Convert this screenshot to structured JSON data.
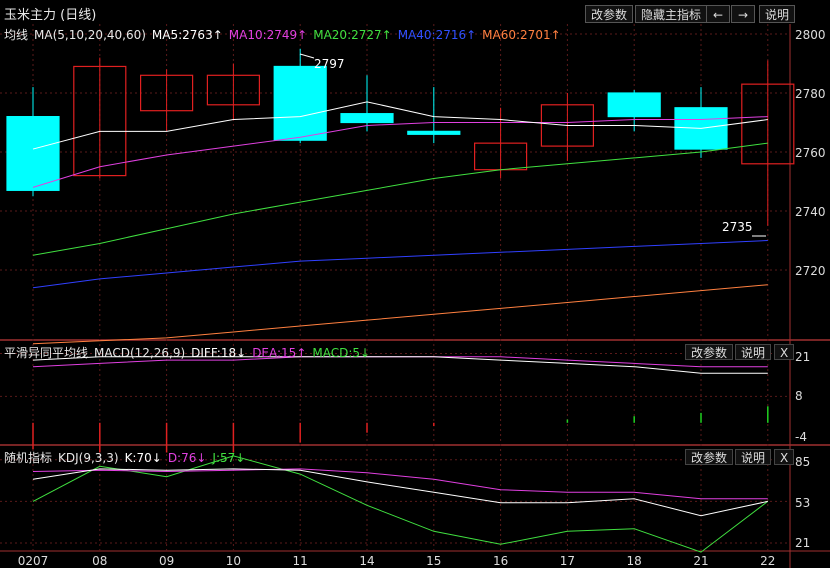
{
  "window": {
    "title": "玉米主力 (日线)"
  },
  "toolbar": {
    "params": "改参数",
    "hide_main": "隐藏主指标",
    "left_arrow": "←",
    "right_arrow": "→",
    "help": "说明"
  },
  "main_panel": {
    "legend": {
      "name": "均线",
      "params": "MA(5,10,20,40,60)",
      "ma5": "MA5:2763↑",
      "ma10": "MA10:2749↑",
      "ma20": "MA20:2727↑",
      "ma40": "MA40:2716↑",
      "ma60": "MA60:2701↑"
    },
    "colors": {
      "ma5": "#ffffff",
      "ma10": "#e040e0",
      "ma20": "#40e040",
      "ma40": "#3040ff",
      "ma60": "#ff8040",
      "up": "#e02020",
      "down": "#00ffff"
    },
    "high_label": "2797",
    "low_label": "2735",
    "yticks": [
      "2800",
      "2780",
      "2760",
      "2740",
      "2720"
    ]
  },
  "macd_panel": {
    "legend": {
      "name": "平滑异同平均线",
      "params": "MACD(12,26,9)",
      "diff": "DIFF:18↓",
      "dea": "DEA:15↑",
      "macd": "MACD:5↓"
    },
    "params_btn": "改参数",
    "help_btn": "说明",
    "close_btn": "X",
    "yticks": [
      "21",
      "8",
      "-4"
    ]
  },
  "kdj_panel": {
    "legend": {
      "name": "随机指标",
      "params": "KDJ(9,3,3)",
      "k": "K:70↓",
      "d": "D:76↓",
      "j": "J:57↓"
    },
    "params_btn": "改参数",
    "help_btn": "说明",
    "close_btn": "X",
    "yticks": [
      "85",
      "53",
      "21"
    ]
  },
  "xaxis": {
    "labels": [
      "0207",
      "08",
      "09",
      "10",
      "11",
      "14",
      "15",
      "16",
      "17",
      "18",
      "21",
      "22"
    ]
  },
  "chart_data": {
    "type": "candlestick",
    "x": [
      "0207",
      "08",
      "09",
      "10",
      "11",
      "14",
      "15",
      "16",
      "17",
      "18",
      "21",
      "22"
    ],
    "candles": [
      {
        "open": 2772,
        "close": 2747,
        "high": 2782,
        "low": 2745
      },
      {
        "open": 2752,
        "close": 2789,
        "high": 2792,
        "low": 2751
      },
      {
        "open": 2774,
        "close": 2786,
        "high": 2788,
        "low": 2767
      },
      {
        "open": 2776,
        "close": 2786,
        "high": 2790,
        "low": 2771
      },
      {
        "open": 2789,
        "close": 2764,
        "high": 2795,
        "low": 2763
      },
      {
        "open": 2773,
        "close": 2770,
        "high": 2786,
        "low": 2767
      },
      {
        "open": 2767,
        "close": 2766,
        "high": 2782,
        "low": 2763
      },
      {
        "open": 2754,
        "close": 2763,
        "high": 2775,
        "low": 2751
      },
      {
        "open": 2762,
        "close": 2776,
        "high": 2780,
        "low": 2757
      },
      {
        "open": 2780,
        "close": 2772,
        "high": 2781,
        "low": 2767
      },
      {
        "open": 2775,
        "close": 2761,
        "high": 2782,
        "low": 2758
      },
      {
        "open": 2756,
        "close": 2783,
        "high": 2791,
        "low": 2735
      }
    ],
    "ma5": [
      2761,
      2767,
      2767,
      2771,
      2772,
      2777,
      2772,
      2771,
      2769,
      2769,
      2768,
      2771
    ],
    "ma10": [
      2748,
      2755,
      2759,
      2762,
      2765,
      2769,
      2770,
      2770,
      2770,
      2771,
      2771,
      2772
    ],
    "ma20": [
      2725,
      2729,
      2734,
      2739,
      2743,
      2747,
      2751,
      2754,
      2756,
      2758,
      2760,
      2763
    ],
    "ma40": [
      2714,
      2717,
      2719,
      2721,
      2723,
      2724,
      2725,
      2726,
      2727,
      2728,
      2729,
      2730
    ],
    "ma60": [
      2695,
      2696,
      2697,
      2699,
      2701,
      2703,
      2705,
      2707,
      2709,
      2711,
      2713,
      2715
    ],
    "ylim": [
      2693,
      2803
    ],
    "macd": {
      "diff": [
        19,
        20,
        20,
        20,
        20,
        20,
        20,
        19,
        18,
        17,
        15,
        15
      ],
      "dea": [
        17,
        18,
        19,
        19,
        20,
        20,
        20,
        20,
        19,
        18,
        17,
        17
      ],
      "macd": [
        -8,
        -9,
        -9,
        -9,
        -6,
        -3,
        -1,
        0,
        1,
        2,
        3,
        5
      ],
      "ylim": [
        -5,
        22
      ]
    },
    "kdj": {
      "k": [
        70,
        78,
        77,
        78,
        77,
        68,
        60,
        52,
        52,
        55,
        42,
        53
      ],
      "d": [
        76,
        77,
        76,
        77,
        78,
        75,
        70,
        62,
        60,
        60,
        55,
        55
      ],
      "j": [
        53,
        80,
        72,
        88,
        74,
        50,
        30,
        20,
        30,
        32,
        14,
        53
      ],
      "ylim": [
        12,
        92
      ]
    }
  }
}
